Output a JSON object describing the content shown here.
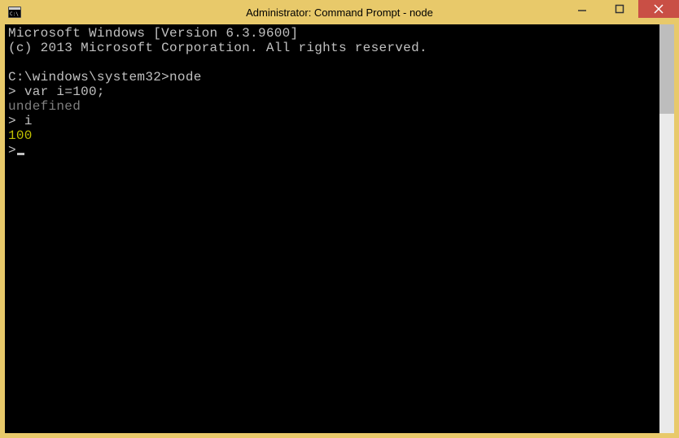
{
  "window": {
    "title": "Administrator: Command Prompt - node"
  },
  "terminal": {
    "lines": {
      "l0": "Microsoft Windows [Version 6.3.9600]",
      "l1": "(c) 2013 Microsoft Corporation. All rights reserved.",
      "l2": "",
      "l3_prompt": "C:\\windows\\system32>",
      "l3_cmd": "node",
      "l4_prompt": "> ",
      "l4_input": "var i=100;",
      "l5": "undefined",
      "l6_prompt": "> ",
      "l6_input": "i",
      "l7": "100",
      "l8_prompt": ">"
    }
  }
}
